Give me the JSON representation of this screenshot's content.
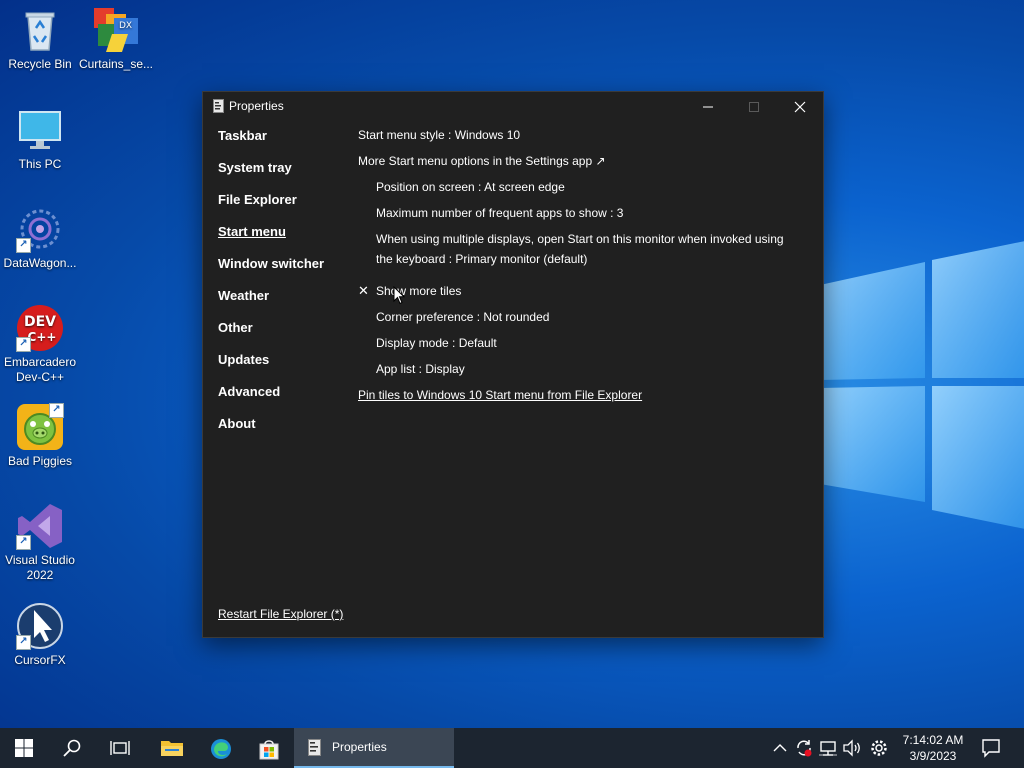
{
  "desktop": {
    "icons": [
      {
        "label": "Recycle Bin"
      },
      {
        "label": "Curtains_se..."
      },
      {
        "label": "This PC"
      },
      {
        "label": "DataWagon..."
      },
      {
        "label": "Embarcadero Dev-C++"
      },
      {
        "label": "Bad Piggies"
      },
      {
        "label": "Visual Studio 2022"
      },
      {
        "label": "CursorFX"
      }
    ],
    "dev_badge_top": "DEV",
    "dev_badge_bottom": "C++"
  },
  "window": {
    "title": "Properties",
    "nav": [
      {
        "label": "Taskbar"
      },
      {
        "label": "System tray"
      },
      {
        "label": "File Explorer"
      },
      {
        "label": "Start menu",
        "active": true
      },
      {
        "label": "Window switcher"
      },
      {
        "label": "Weather"
      },
      {
        "label": "Other"
      },
      {
        "label": "Updates"
      },
      {
        "label": "Advanced"
      },
      {
        "label": "About"
      }
    ],
    "settings": {
      "start_menu_style": "Start menu style : Windows 10",
      "more_options": "More Start menu options in the Settings app ↗",
      "position": "Position on screen : At screen edge",
      "max_frequent": "Maximum number of frequent apps to show : 3",
      "multi_display_line1": "When using multiple displays, open Start on this monitor when invoked using",
      "multi_display_line2": "the keyboard : Primary monitor (default)",
      "show_more_tiles": "Show more tiles",
      "show_more_tiles_checked": "✕",
      "corner_preference": "Corner preference : Not rounded",
      "display_mode": "Display mode : Default",
      "app_list": "App list : Display",
      "pin_tiles_link": "Pin tiles to Windows 10 Start menu from File Explorer"
    },
    "footer_link": "Restart File Explorer (*)"
  },
  "taskbar": {
    "task_label": "Properties",
    "time": "7:14:02 AM",
    "date": "3/9/2023"
  },
  "colors": {
    "window_bg": "#202020",
    "taskbar_bg": "#1c2530",
    "accent": "#76b9ed",
    "desktop_blue": "#0b63cf"
  }
}
